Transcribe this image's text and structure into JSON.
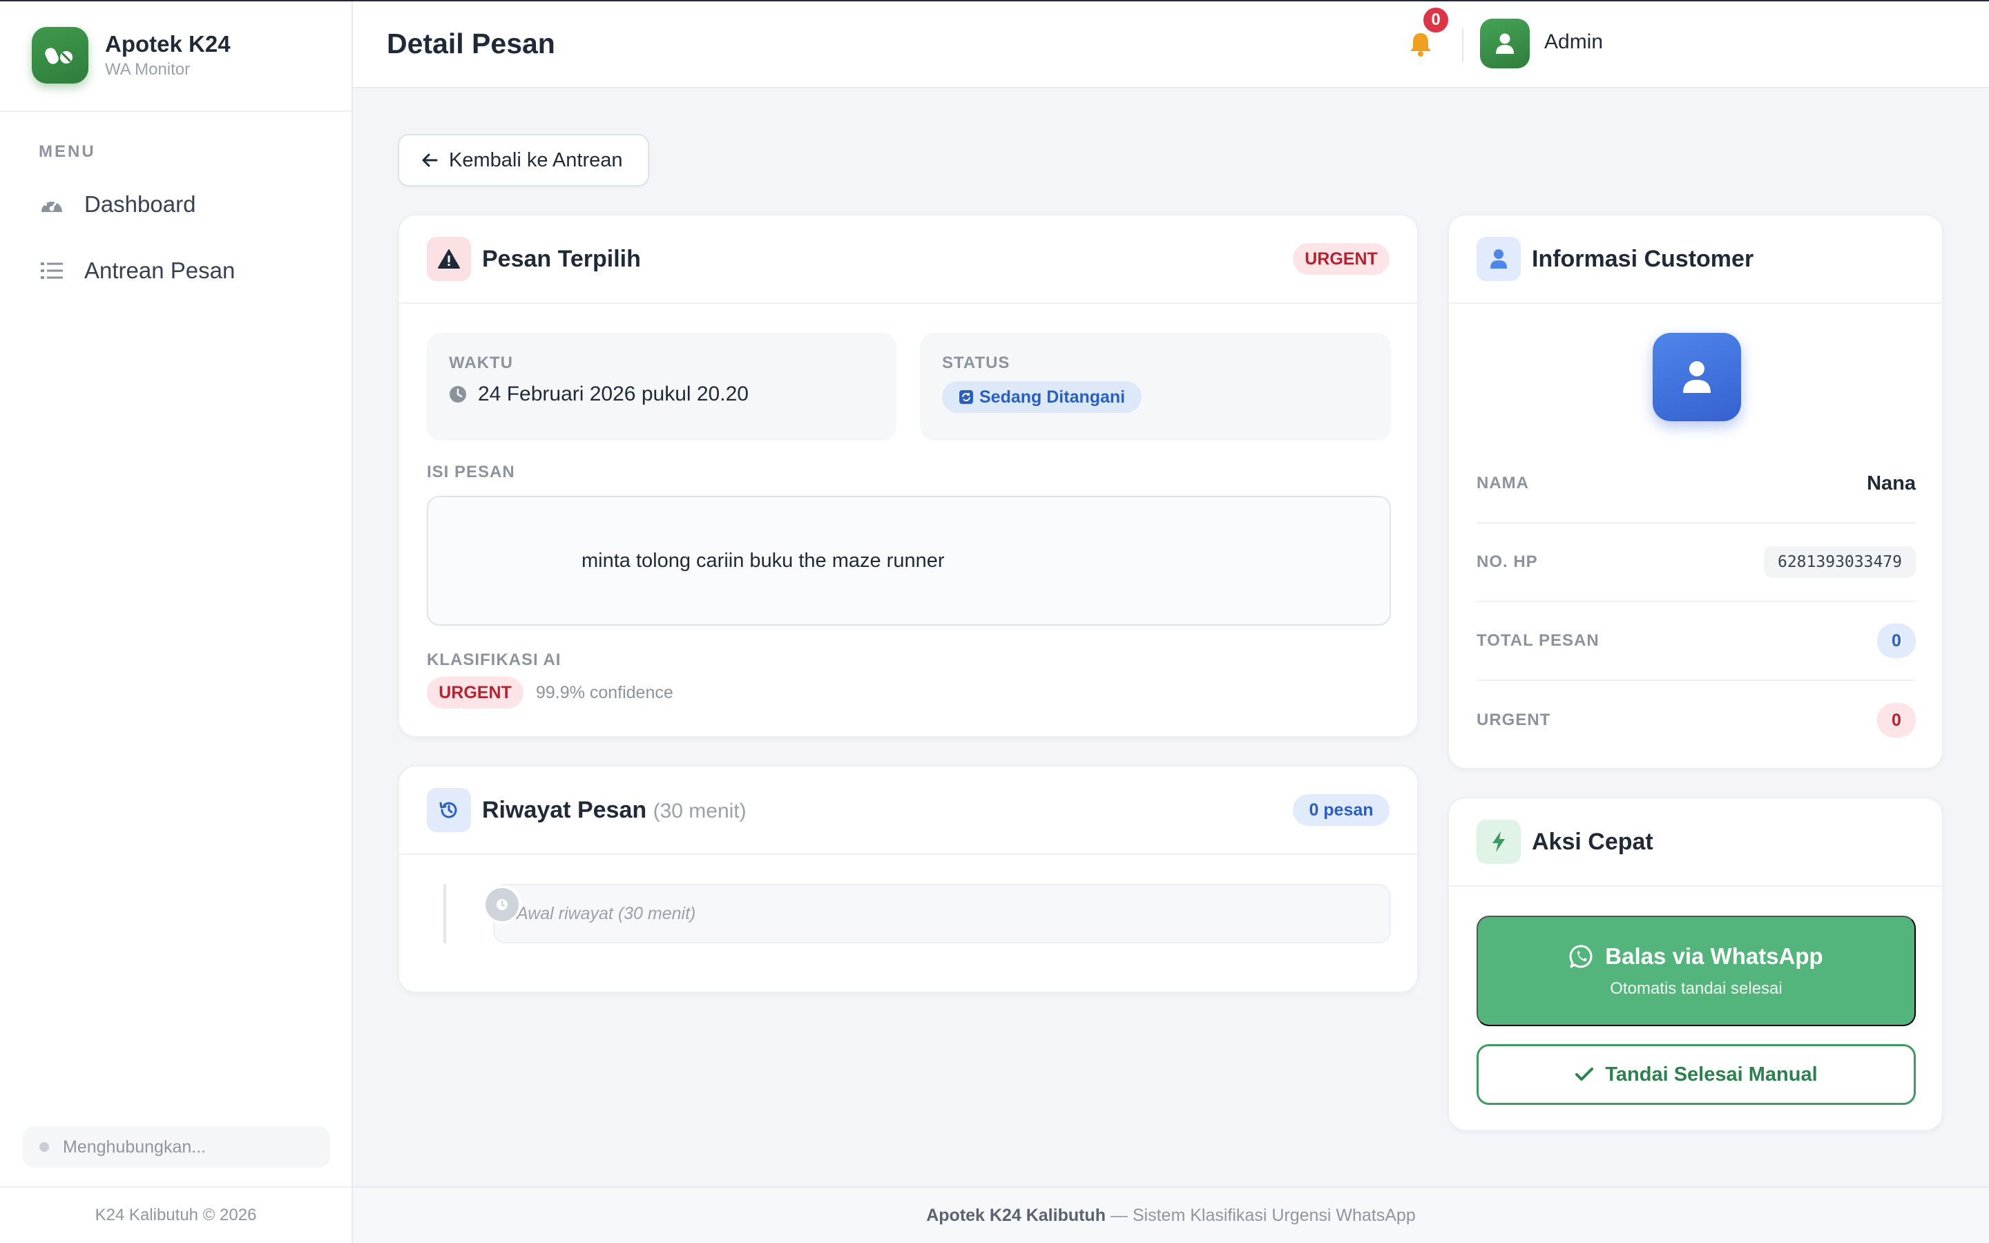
{
  "brand": {
    "title": "Apotek K24",
    "subtitle": "WA Monitor"
  },
  "sidebar": {
    "menu_label": "MENU",
    "items": [
      {
        "label": "Dashboard",
        "icon": "gauge-icon"
      },
      {
        "label": "Antrean Pesan",
        "icon": "list-icon"
      }
    ],
    "connection_status": "Menghubungkan...",
    "footer": "K24 Kalibutuh © 2026"
  },
  "header": {
    "title": "Detail Pesan",
    "notification_count": "0",
    "user_name": "Admin"
  },
  "back_button": {
    "label": "Kembali ke Antrean"
  },
  "message_card": {
    "title": "Pesan Terpilih",
    "badge": "URGENT",
    "time_label": "WAKTU",
    "time_value": "24 Februari 2026 pukul 20.20",
    "status_label": "STATUS",
    "status_value": "Sedang Ditangani",
    "content_label": "ISI PESAN",
    "content": "minta tolong cariin buku the maze runner",
    "classification_label": "KLASIFIKASI AI",
    "classification_value": "URGENT",
    "confidence": "99.9% confidence"
  },
  "history_card": {
    "title": "Riwayat Pesan",
    "subtitle": "(30 menit)",
    "count": "0 pesan",
    "item_text": "Awal riwayat (30 menit)"
  },
  "customer_card": {
    "title": "Informasi Customer",
    "name_label": "NAMA",
    "name_value": "Nana",
    "phone_label": "NO. HP",
    "phone_value": "6281393033479",
    "total_label": "TOTAL PESAN",
    "total_value": "0",
    "urgent_label": "URGENT",
    "urgent_value": "0"
  },
  "quick_actions": {
    "title": "Aksi Cepat",
    "whatsapp_label": "Balas via WhatsApp",
    "whatsapp_sub": "Otomatis tandai selesai",
    "manual_label": "Tandai Selesai Manual"
  },
  "footer": {
    "brand": "Apotek K24 Kalibutuh",
    "text": " — Sistem Klasifikasi Urgensi WhatsApp"
  },
  "colors": {
    "brand_green": "#2f7d3c",
    "urgent_red": "#b42332",
    "info_blue": "#2a5fc0",
    "whatsapp_green": "#53b57c"
  }
}
